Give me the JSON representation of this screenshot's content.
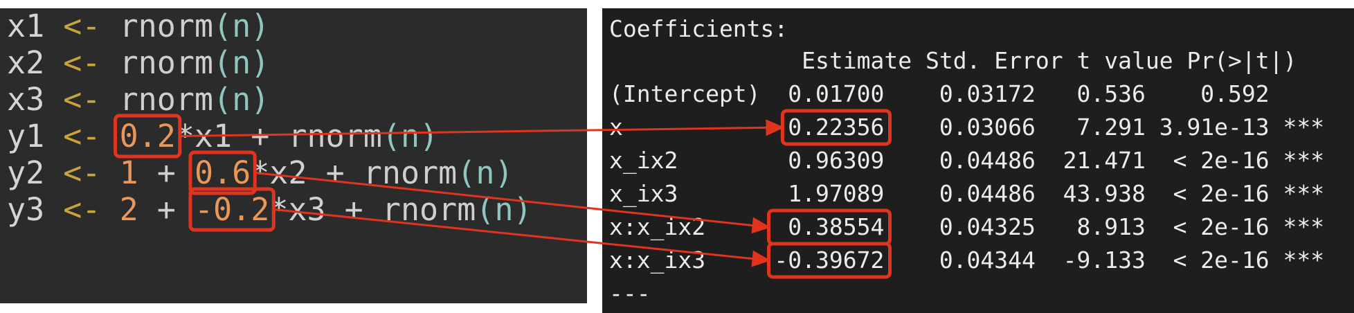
{
  "code": {
    "lines": [
      {
        "tokens": [
          "x1",
          " <- ",
          "rnorm",
          "(",
          "n",
          ")"
        ]
      },
      {
        "tokens": [
          "x2",
          " <- ",
          "rnorm",
          "(",
          "n",
          ")"
        ]
      },
      {
        "tokens": [
          "x3",
          " <- ",
          "rnorm",
          "(",
          "n",
          ")"
        ]
      },
      {
        "tokens": [
          "y1",
          " <- ",
          "0.2",
          "*x1 + ",
          "rnorm",
          "(",
          "n",
          ")"
        ]
      },
      {
        "tokens": [
          "y2",
          " <- ",
          "1",
          " + ",
          "0.6",
          "*x2 + ",
          "rnorm",
          "(",
          "n",
          ")"
        ]
      },
      {
        "tokens": [
          "y3",
          " <- ",
          "2",
          " + ",
          "-0.2",
          "*x3 + ",
          "rnorm",
          "(",
          "n",
          ")"
        ]
      }
    ]
  },
  "output": {
    "title": "Coefficients:",
    "header": "              Estimate Std. Error t value Pr(>|t|)    ",
    "rows": [
      "(Intercept)  0.01700    0.03172   0.536    0.592    ",
      "x            0.22356    0.03066   7.291 3.91e-13 ***",
      "x_ix2        0.96309    0.04486  21.471  < 2e-16 ***",
      "x_ix3        1.97089    0.04486  43.938  < 2e-16 ***",
      "x:x_ix2      0.38554    0.04325   8.913  < 2e-16 ***",
      "x:x_ix3     -0.39672    0.04344  -9.133  < 2e-16 ***"
    ],
    "trailer": "---"
  },
  "colors": {
    "highlight": "#e0341f",
    "left_bg": "#2b2b2b",
    "right_bg": "#1e1e1e"
  }
}
